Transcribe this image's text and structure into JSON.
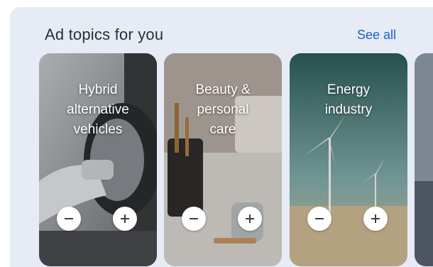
{
  "section": {
    "title": "Ad topics for you",
    "see_all": "See all"
  },
  "cards": [
    {
      "label": "Hybrid\nalternative\nvehicles",
      "minus_icon": "minus-icon",
      "plus_icon": "plus-icon"
    },
    {
      "label": "Beauty &\npersonal\ncare",
      "minus_icon": "minus-icon",
      "plus_icon": "plus-icon"
    },
    {
      "label": "Energy\nindustry",
      "minus_icon": "minus-icon",
      "plus_icon": "plus-icon"
    }
  ],
  "colors": {
    "panel_bg": "#e6ebf5",
    "link": "#1a5fc8",
    "title_text": "#2a2f36"
  }
}
